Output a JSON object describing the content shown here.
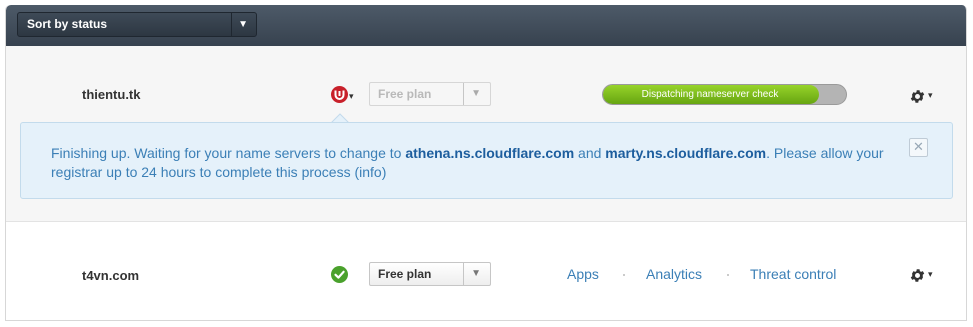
{
  "toolbar": {
    "sort_label": "Sort by status"
  },
  "sites": [
    {
      "domain": "thientu.tk",
      "status": "error",
      "plan": "Free plan",
      "progress": {
        "label": "Dispatching nameserver check",
        "fraction": 0.89
      },
      "notice": {
        "text_1": "Finishing up. Waiting for your name servers to change to ",
        "ns1": "athena.ns.cloudflare.com",
        "text_2": " and ",
        "ns2": "marty.ns.cloudflare.com",
        "text_3": ". Please allow your registrar up to 24 hours to complete this process ",
        "info_link": "(info)",
        "close_glyph": "✕"
      }
    },
    {
      "domain": "t4vn.com",
      "status": "active",
      "plan": "Free plan",
      "links": [
        "Apps",
        "Analytics",
        "Threat control"
      ]
    }
  ],
  "icons": {
    "sort_arrow": "▼",
    "plan_arrow": "▼",
    "caret": "▾",
    "status_error": "alert-icon",
    "status_ok": "checkmark-icon",
    "settings": "gear-icon"
  },
  "colors": {
    "topbar": "#3f4a57",
    "progress_fill": "#7cc21c",
    "link": "#3b7fb6",
    "error": "#c8202a",
    "ok": "#4aa12c"
  }
}
